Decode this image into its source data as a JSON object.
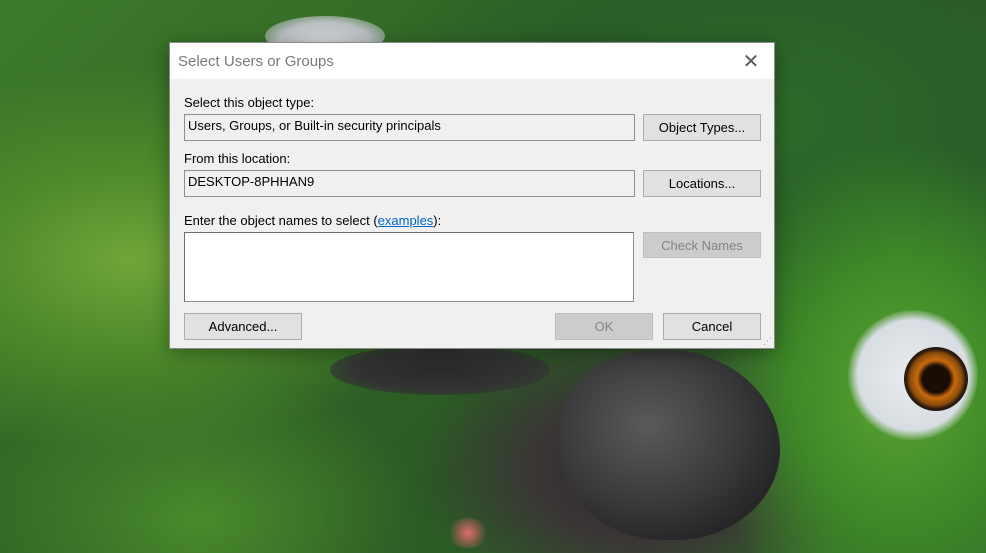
{
  "dialog": {
    "title": "Select Users or Groups",
    "close_icon": "close-icon",
    "object_type": {
      "label": "Select this object type:",
      "value": "Users, Groups, or Built-in security principals",
      "button": "Object Types..."
    },
    "location": {
      "label": "From this location:",
      "value": "DESKTOP-8PHHAN9",
      "button": "Locations..."
    },
    "names": {
      "label_prefix": "Enter the object names to select (",
      "link": "examples",
      "label_suffix": "):",
      "value": "",
      "check_button": "Check Names"
    },
    "buttons": {
      "advanced": "Advanced...",
      "ok": "OK",
      "cancel": "Cancel"
    },
    "resize_icon": "resize-grip-icon"
  }
}
